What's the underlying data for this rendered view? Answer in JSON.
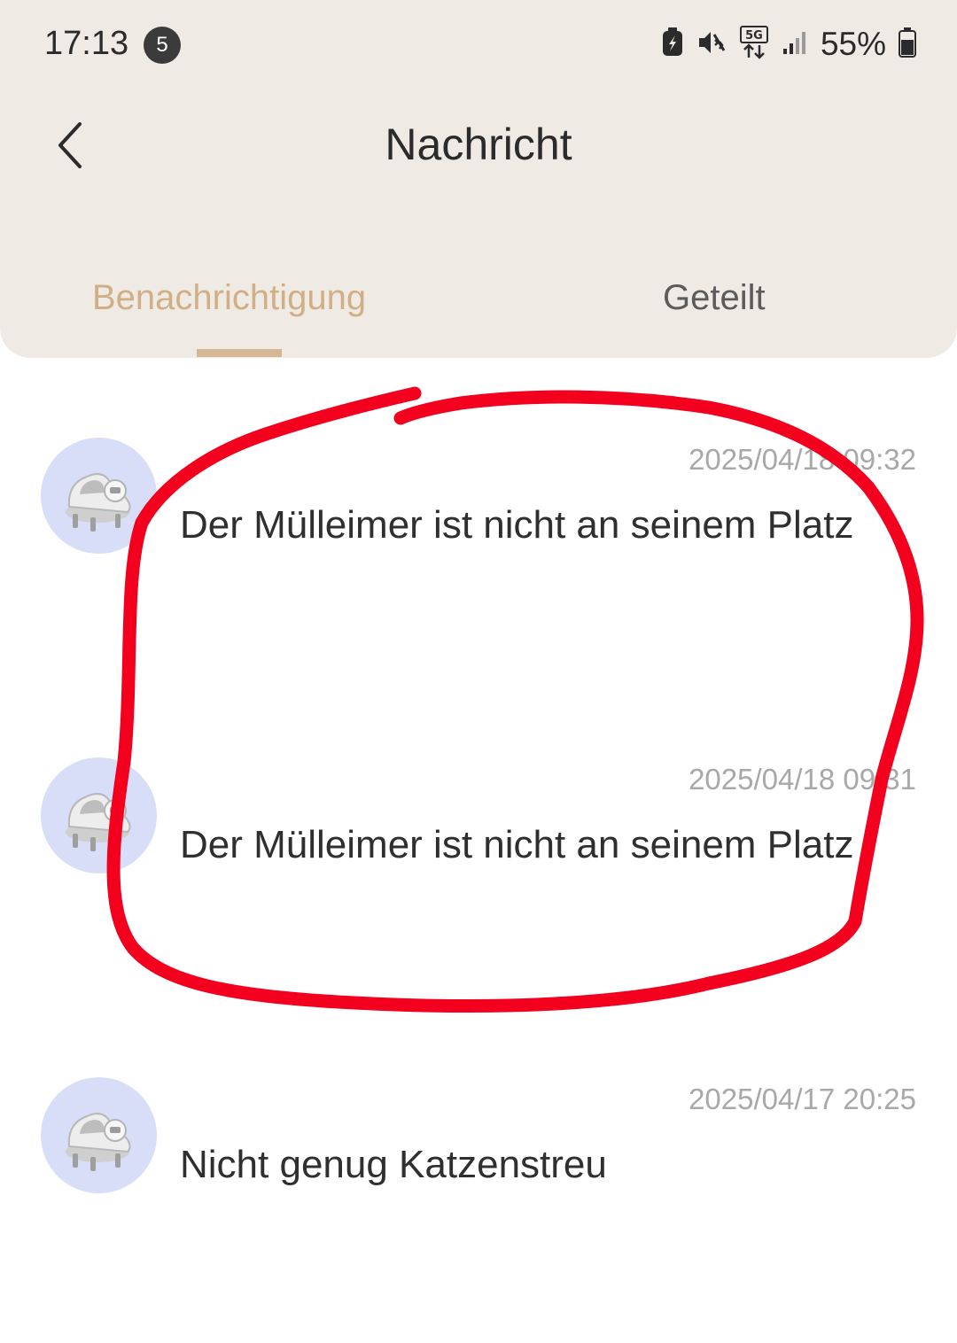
{
  "status_bar": {
    "time": "17:13",
    "notification_count": "5",
    "network": "5G",
    "battery": "55%"
  },
  "header": {
    "title": "Nachricht"
  },
  "tabs": [
    {
      "label": "Benachrichtigung",
      "active": true
    },
    {
      "label": "Geteilt",
      "active": false
    }
  ],
  "messages": [
    {
      "timestamp": "2025/04/18 09:32",
      "text": "Der Mülleimer ist nicht an seinem Platz",
      "icon": "litter-box-device-icon"
    },
    {
      "timestamp": "2025/04/18 09:31",
      "text": "Der Mülleimer ist nicht an seinem Platz",
      "icon": "litter-box-device-icon"
    },
    {
      "timestamp": "2025/04/17 20:25",
      "text": "Nicht genug Katzenstreu",
      "icon": "litter-box-device-icon"
    }
  ],
  "colors": {
    "header_bg": "#efebe4",
    "active_tab": "#d1af86",
    "avatar_bg": "#d9def8",
    "annotation": "#f2001e"
  }
}
